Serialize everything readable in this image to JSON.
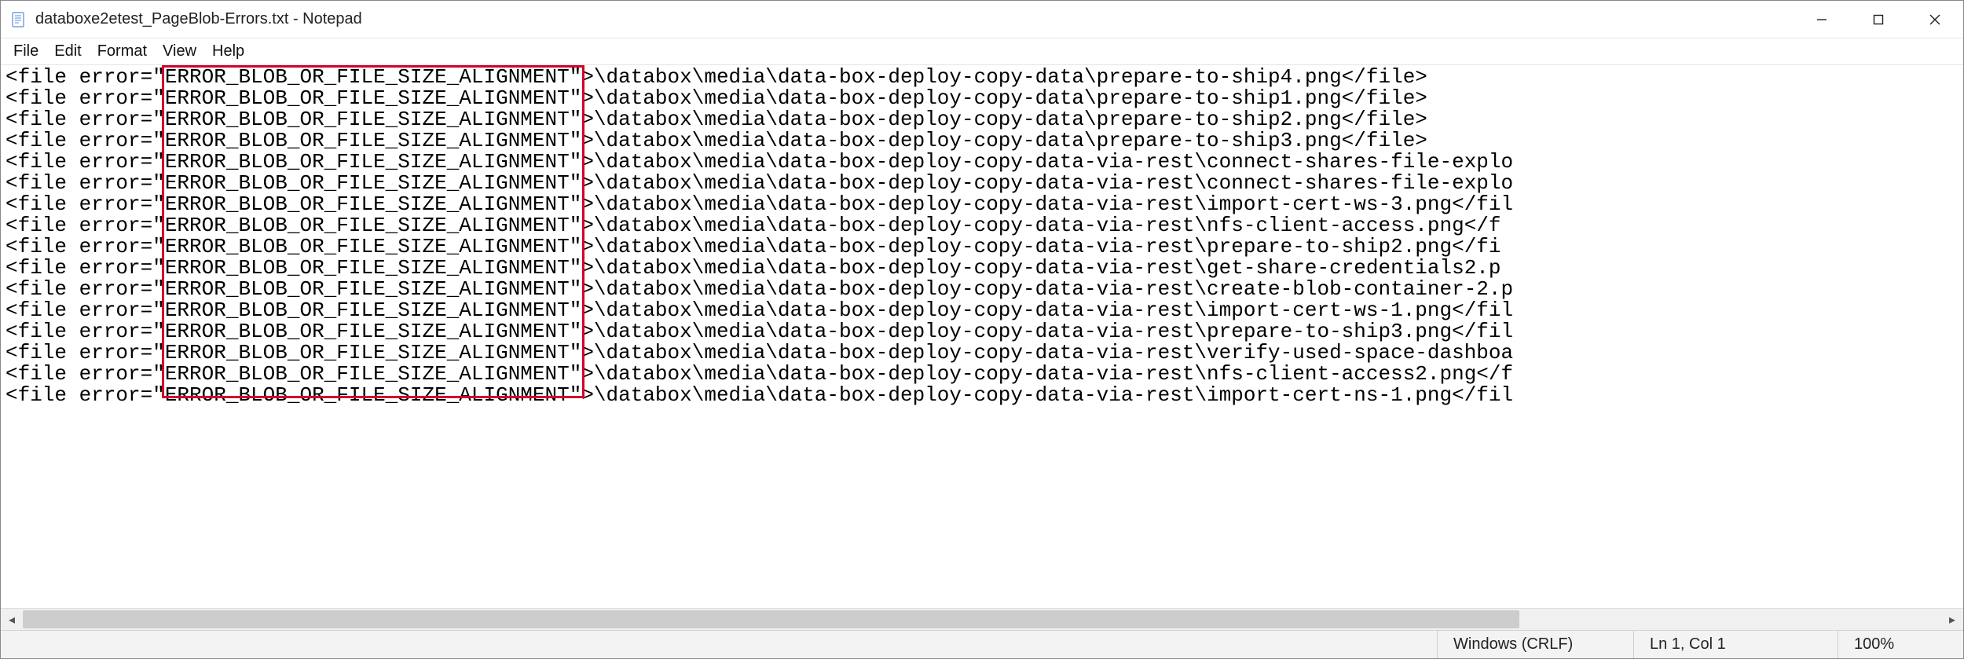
{
  "window": {
    "icon_name": "notepad-icon",
    "title": "databoxe2etest_PageBlob-Errors.txt - Notepad"
  },
  "window_controls": {
    "minimize": "minimize-icon",
    "maximize": "maximize-icon",
    "close": "close-icon"
  },
  "menu": {
    "file": "File",
    "edit": "Edit",
    "format": "Format",
    "view": "View",
    "help": "Help"
  },
  "highlight": {
    "note": "Lines 1-16 full error code highlighted; line 17 partial highlight",
    "text": "ERROR_BLOB_OR_FILE_SIZE_ALIGNMENT"
  },
  "content": {
    "lines": [
      "<file error=\"ERROR_BLOB_OR_FILE_SIZE_ALIGNMENT\">\\databox\\media\\data-box-deploy-copy-data\\prepare-to-ship4.png</file>",
      "<file error=\"ERROR_BLOB_OR_FILE_SIZE_ALIGNMENT\">\\databox\\media\\data-box-deploy-copy-data\\prepare-to-ship1.png</file>",
      "<file error=\"ERROR_BLOB_OR_FILE_SIZE_ALIGNMENT\">\\databox\\media\\data-box-deploy-copy-data\\prepare-to-ship2.png</file>",
      "<file error=\"ERROR_BLOB_OR_FILE_SIZE_ALIGNMENT\">\\databox\\media\\data-box-deploy-copy-data\\prepare-to-ship3.png</file>",
      "<file error=\"ERROR_BLOB_OR_FILE_SIZE_ALIGNMENT\">\\databox\\media\\data-box-deploy-copy-data-via-rest\\connect-shares-file-explo",
      "<file error=\"ERROR_BLOB_OR_FILE_SIZE_ALIGNMENT\">\\databox\\media\\data-box-deploy-copy-data-via-rest\\connect-shares-file-explo",
      "<file error=\"ERROR_BLOB_OR_FILE_SIZE_ALIGNMENT\">\\databox\\media\\data-box-deploy-copy-data-via-rest\\import-cert-ws-3.png</fil",
      "<file error=\"ERROR_BLOB_OR_FILE_SIZE_ALIGNMENT\">\\databox\\media\\data-box-deploy-copy-data-via-rest\\nfs-client-access.png</f",
      "<file error=\"ERROR_BLOB_OR_FILE_SIZE_ALIGNMENT\">\\databox\\media\\data-box-deploy-copy-data-via-rest\\prepare-to-ship2.png</fi",
      "<file error=\"ERROR_BLOB_OR_FILE_SIZE_ALIGNMENT\">\\databox\\media\\data-box-deploy-copy-data-via-rest\\get-share-credentials2.p",
      "<file error=\"ERROR_BLOB_OR_FILE_SIZE_ALIGNMENT\">\\databox\\media\\data-box-deploy-copy-data-via-rest\\create-blob-container-2.p",
      "<file error=\"ERROR_BLOB_OR_FILE_SIZE_ALIGNMENT\">\\databox\\media\\data-box-deploy-copy-data-via-rest\\import-cert-ws-1.png</fil",
      "<file error=\"ERROR_BLOB_OR_FILE_SIZE_ALIGNMENT\">\\databox\\media\\data-box-deploy-copy-data-via-rest\\prepare-to-ship3.png</fil",
      "<file error=\"ERROR_BLOB_OR_FILE_SIZE_ALIGNMENT\">\\databox\\media\\data-box-deploy-copy-data-via-rest\\verify-used-space-dashboa",
      "<file error=\"ERROR_BLOB_OR_FILE_SIZE_ALIGNMENT\">\\databox\\media\\data-box-deploy-copy-data-via-rest\\nfs-client-access2.png</f",
      "<file error=\"ERROR_BLOB_OR_FILE_SIZE_ALIGNMENT\">\\databox\\media\\data-box-deploy-copy-data-via-rest\\import-cert-ns-1.png</fil"
    ]
  },
  "status": {
    "line_ending": "Windows (CRLF)",
    "position": "Ln 1, Col 1",
    "zoom": "100%"
  }
}
